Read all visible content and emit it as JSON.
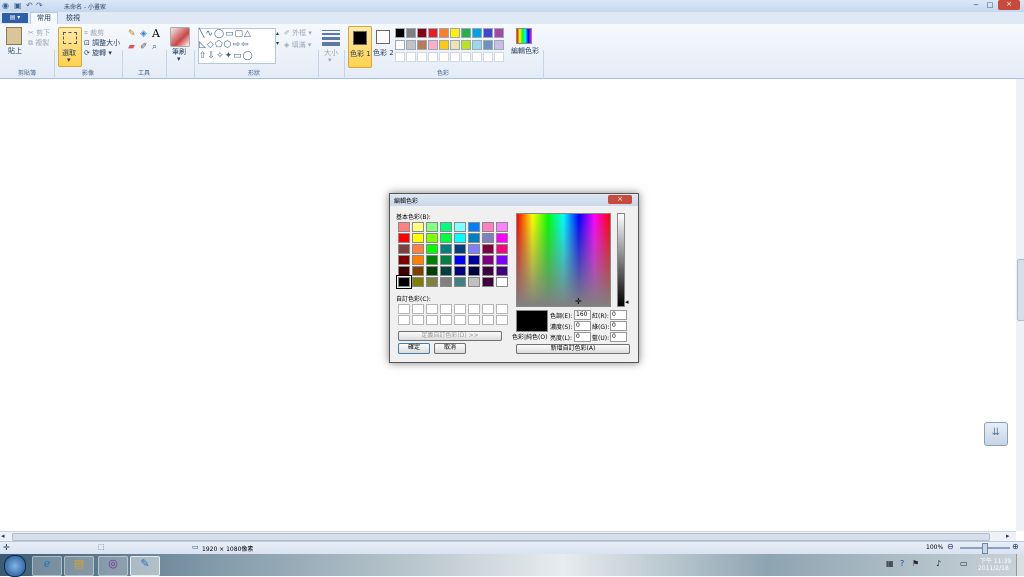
{
  "window": {
    "title": "未命名 - 小畫家",
    "controls": [
      "−",
      "□",
      "×"
    ]
  },
  "ribbon_tabs": {
    "file": "▤ ▾",
    "home": "常用",
    "view": "檢視"
  },
  "clipboard": {
    "paste": "貼上",
    "cut": "剪下",
    "copy": "複製",
    "label": "剪貼簿"
  },
  "image": {
    "select": "選取",
    "crop": "裁剪",
    "resize": "調整大小",
    "rotate": "旋轉",
    "label": "影像"
  },
  "tools": {
    "label": "工具"
  },
  "brushes": {
    "label": "筆刷"
  },
  "shapes": {
    "outline": "外框",
    "fill": "填滿",
    "label": "形狀"
  },
  "size": {
    "label": "大小"
  },
  "colors": {
    "color1": "色彩 1",
    "color2": "色彩 2",
    "edit": "編輯色彩",
    "label": "色彩",
    "row1": [
      "#000000",
      "#7f7f7f",
      "#880015",
      "#ed1c24",
      "#ff7f27",
      "#fff200",
      "#22b14c",
      "#00a2e8",
      "#3f48cc",
      "#a349a4"
    ],
    "row2": [
      "#ffffff",
      "#c3c3c3",
      "#b97a57",
      "#ffaec9",
      "#ffc90e",
      "#efe4b0",
      "#b5e61d",
      "#99d9ea",
      "#7092be",
      "#c8bfe7"
    ],
    "row3": [
      "#ffffff",
      "#ffffff",
      "#ffffff",
      "#ffffff",
      "#ffffff",
      "#ffffff",
      "#ffffff",
      "#ffffff",
      "#ffffff",
      "#ffffff"
    ]
  },
  "dialog": {
    "title": "編輯色彩",
    "close": "×",
    "basic_colors_label": "基本色彩(B):",
    "basic_colors": [
      [
        "#ff8080",
        "#ffff80",
        "#80ff80",
        "#00ff80",
        "#80ffff",
        "#0080ff",
        "#ff80c0",
        "#ff80ff"
      ],
      [
        "#ff0000",
        "#ffff00",
        "#80ff00",
        "#00ff40",
        "#00ffff",
        "#0080c0",
        "#8080c0",
        "#ff00ff"
      ],
      [
        "#804040",
        "#ff8040",
        "#00ff00",
        "#008080",
        "#004080",
        "#8080ff",
        "#800040",
        "#ff0080"
      ],
      [
        "#800000",
        "#ff8000",
        "#008000",
        "#008040",
        "#0000ff",
        "#0000a0",
        "#800080",
        "#8000ff"
      ],
      [
        "#400000",
        "#804000",
        "#004000",
        "#004040",
        "#000080",
        "#000040",
        "#400040",
        "#400080"
      ],
      [
        "#000000",
        "#808000",
        "#808040",
        "#808080",
        "#408080",
        "#c0c0c0",
        "#400040",
        "#ffffff"
      ]
    ],
    "custom_colors_label": "自訂色彩(C):",
    "define_button": "定義自訂色彩(D) >>",
    "ok": "確定",
    "cancel": "取消",
    "color_solid_label": "色彩|純色(O)",
    "hue_label": "色調(E):",
    "hue": "160",
    "sat_label": "濃度(S):",
    "sat": "0",
    "lum_label": "亮度(L):",
    "lum": "0",
    "red_label": "紅(R):",
    "red": "0",
    "green_label": "綠(G):",
    "green": "0",
    "blue_label": "藍(U):",
    "blue": "0",
    "add_button": "新增自訂色彩(A)"
  },
  "status": {
    "dimensions": "1920 × 1080像素",
    "zoom": "100%"
  },
  "taskbar": {
    "time": "下午 11:39",
    "date": "2011/2/18"
  }
}
